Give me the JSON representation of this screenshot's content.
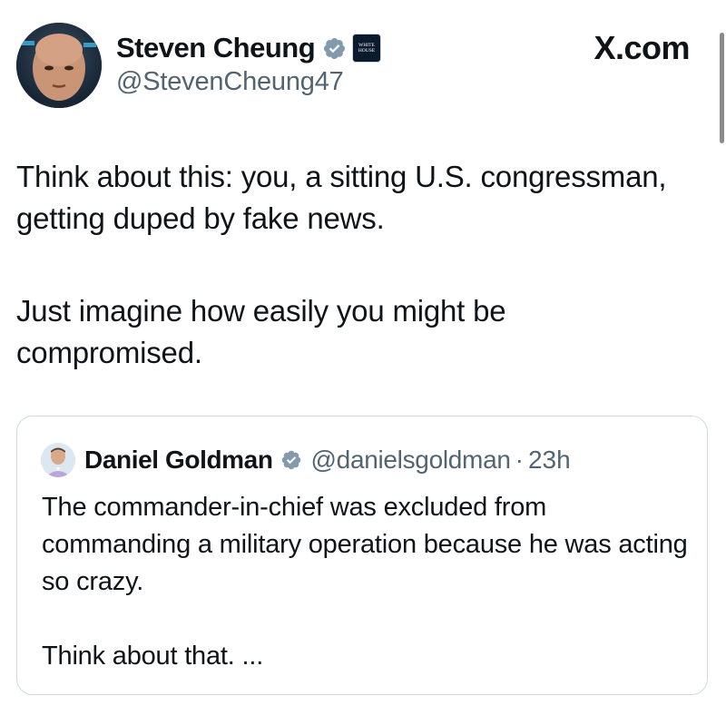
{
  "brand": "X.com",
  "author": {
    "display_name": "Steven Cheung",
    "handle": "@StevenCheung47",
    "verified_icon": "verified-badge-icon",
    "affiliation_icon": "white-house-affiliation-icon",
    "affiliation_text": "WHITE HOUSE"
  },
  "tweet": {
    "line1": "Think about this: you, a sitting U.S. congressman, getting duped by fake news.",
    "line2": "Just imagine how easily you might be compromised."
  },
  "quoted": {
    "display_name": "Daniel Goldman",
    "handle": "@danielsgoldman",
    "separator": "·",
    "time": "23h",
    "line1": "The commander-in-chief was excluded from commanding a military operation because he was acting so crazy.",
    "line2": "Think about that. ..."
  },
  "colors": {
    "verified_blue": "#829aab",
    "text": "#0f1419",
    "secondary": "#536471",
    "border": "#cfd9de"
  }
}
